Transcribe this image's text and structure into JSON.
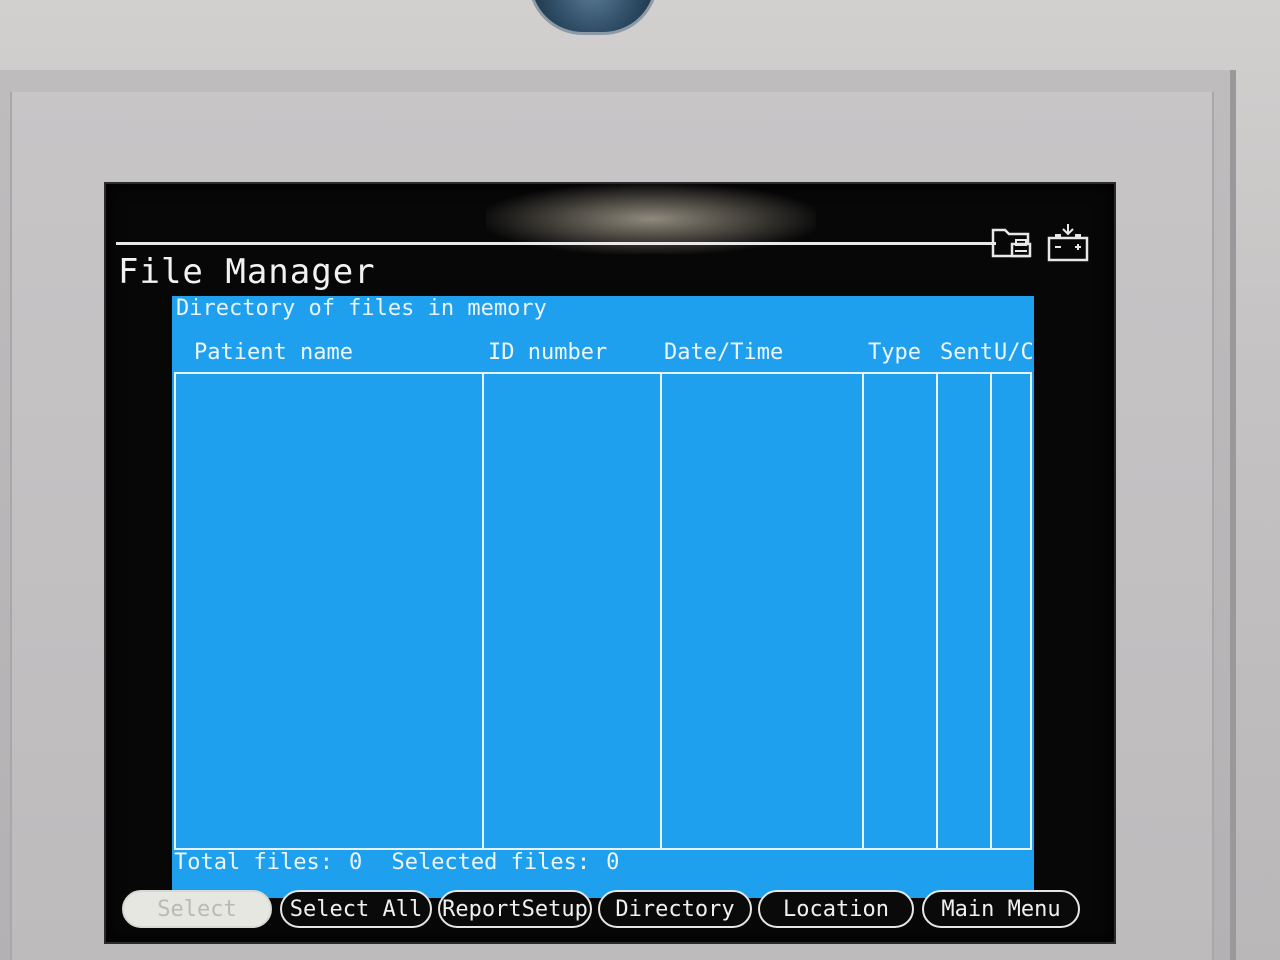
{
  "screen": {
    "title": "File Manager",
    "subtitle": "Directory of files in memory"
  },
  "status_icons": [
    "folder-printer-icon",
    "battery-charge-icon"
  ],
  "table": {
    "columns": [
      "Patient name",
      "ID number",
      "Date/Time",
      "Type",
      "Sent",
      "U/C"
    ],
    "rows": []
  },
  "footer": {
    "total_label": "Total files:",
    "total_value": "0",
    "selected_label": "Selected files:",
    "selected_value": "0"
  },
  "softkeys": [
    {
      "label": "Select",
      "enabled": false
    },
    {
      "label": "Select All",
      "enabled": true
    },
    {
      "label": "ReportSetup",
      "enabled": true
    },
    {
      "label": "Directory",
      "enabled": true
    },
    {
      "label": "Location",
      "enabled": true
    },
    {
      "label": "Main Menu",
      "enabled": true
    }
  ],
  "colors": {
    "panel_blue": "#1ea0ee",
    "screen_black": "#070708",
    "text_white": "#f2f2f2"
  }
}
